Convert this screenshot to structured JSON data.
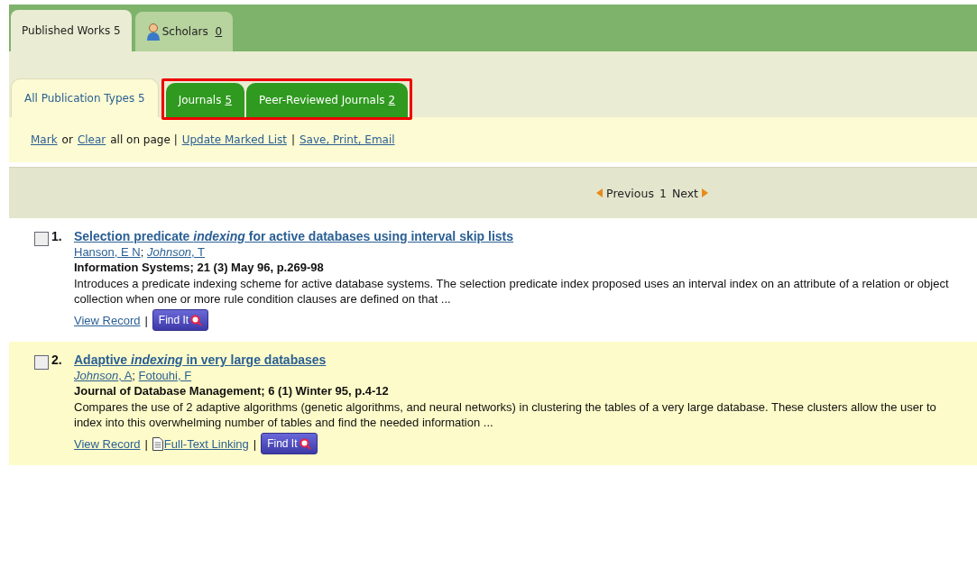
{
  "top_tabs": [
    {
      "label": "Published Works 5",
      "kind": "plain",
      "selected": true
    },
    {
      "label": "Scholars",
      "count": "0",
      "kind": "person",
      "selected": false
    }
  ],
  "sub_tabs": [
    {
      "label": "All Publication Types 5",
      "selected": true,
      "highlighted": false
    },
    {
      "label": "Journals",
      "count": "5",
      "selected": false,
      "highlighted": true
    },
    {
      "label": "Peer-Reviewed Journals",
      "count": "2",
      "selected": false,
      "highlighted": true
    }
  ],
  "toolbar": [
    {
      "kind": "link",
      "text": "Mark"
    },
    {
      "kind": "text",
      "text": "or"
    },
    {
      "kind": "link",
      "text": "Clear"
    },
    {
      "kind": "text",
      "text": "all on page |"
    },
    {
      "kind": "link",
      "text": "Update Marked List"
    },
    {
      "kind": "text",
      "text": "|"
    },
    {
      "kind": "link",
      "text": "Save, Print, Email"
    }
  ],
  "pager": {
    "previous": "Previous",
    "page": "1",
    "next": "Next"
  },
  "results": [
    {
      "number": "1.",
      "checked": false,
      "title": "Selection predicate *indexing* for active databases using interval skip lists",
      "authors": [
        "Hanson, E N",
        "*Johnson*, T"
      ],
      "author_separator": ";",
      "action_separator": "|",
      "source": "Information Systems; 21 (3) May 96, p.269-98",
      "abstract": "Introduces a predicate indexing scheme for active database systems. The selection predicate index proposed uses an interval index on an attribute of a relation or object collection when one or more rule condition clauses are defined on that ...",
      "actions": [
        {
          "kind": "link",
          "text": "View Record"
        },
        {
          "kind": "findit",
          "text": "Find It"
        }
      ]
    },
    {
      "number": "2.",
      "checked": false,
      "title": "Adaptive *indexing* in very large databases",
      "authors": [
        "*Johnson*, A",
        "Fotouhi, F"
      ],
      "author_separator": ";",
      "action_separator": "|",
      "source": "Journal of Database Management; 6 (1) Winter 95, p.4-12",
      "abstract": "Compares the use of 2 adaptive algorithms (genetic algorithms, and neural networks) in clustering the tables of a very large database. These clusters allow the user to index into this overwhelming number of tables and find the needed information ...",
      "actions": [
        {
          "kind": "link",
          "text": "View Record"
        },
        {
          "kind": "fulltext",
          "text": "Full-Text Linking"
        },
        {
          "kind": "findit",
          "text": "Find It"
        }
      ]
    }
  ]
}
